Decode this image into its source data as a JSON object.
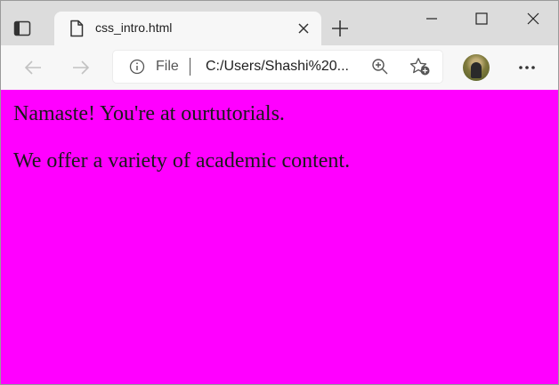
{
  "browser": {
    "tab": {
      "title": "css_intro.html",
      "favicon": "file-page-icon"
    },
    "address_bar": {
      "scheme": "File",
      "url": "C:/Users/Shashi%20..."
    },
    "icons": {
      "tab_actions": "tab-actions-icon",
      "tab_close": "close-icon",
      "new_tab": "plus-icon",
      "minimize": "minimize-icon",
      "maximize": "maximize-icon",
      "window_close": "close-icon",
      "back": "arrow-left-icon",
      "forward": "arrow-right-icon",
      "site_info": "info-icon",
      "zoom": "zoom-in-icon",
      "favorites": "add-favorite-icon",
      "profile": "avatar",
      "menu": "more-horizontal-icon"
    }
  },
  "page": {
    "background": "#ff00ff",
    "paragraphs": [
      "Namaste! You're at ourtutorials.",
      "We offer a variety of academic content."
    ]
  }
}
